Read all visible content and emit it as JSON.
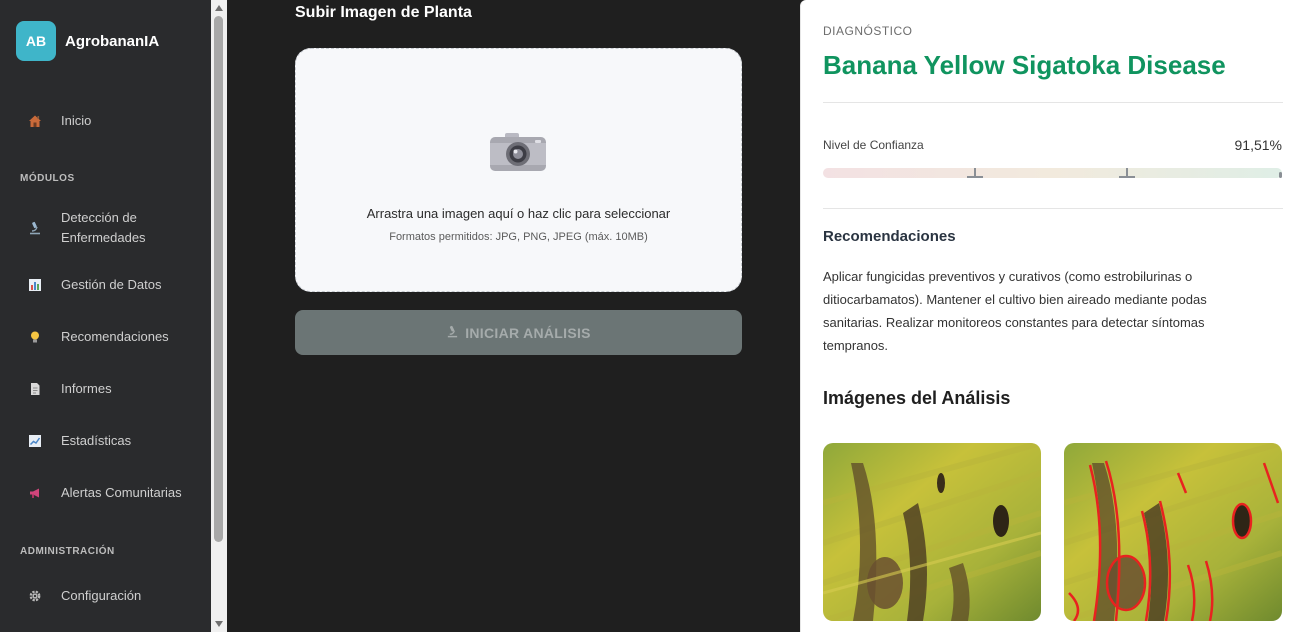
{
  "brand": {
    "logo_text": "AB",
    "name": "AgrobananIA"
  },
  "sidebar": {
    "home": {
      "label": "Inicio",
      "icon": "house-icon"
    },
    "modules_title": "MÓDULOS",
    "modules": [
      {
        "label": "Detección de Enfermedades",
        "icon": "microscope-icon"
      },
      {
        "label": "Gestión de Datos",
        "icon": "bar-chart-icon"
      },
      {
        "label": "Recomendaciones",
        "icon": "lightbulb-icon"
      },
      {
        "label": "Informes",
        "icon": "document-icon"
      },
      {
        "label": "Estadísticas",
        "icon": "line-chart-icon"
      },
      {
        "label": "Alertas Comunitarias",
        "icon": "megaphone-icon"
      }
    ],
    "admin_title": "ADMINISTRACIÓN",
    "admin": [
      {
        "label": "Configuración",
        "icon": "gear-icon"
      }
    ]
  },
  "upload": {
    "title": "Subir Imagen de Planta",
    "drop_text": "Arrastra una imagen aquí o haz clic para seleccionar",
    "formats_text": "Formatos permitidos: JPG, PNG, JPEG (máx. 10MB)",
    "start_button": "INICIAR ANÁLISIS"
  },
  "result": {
    "diagnosis_label": "DIAGNÓSTICO",
    "diagnosis": "Banana Yellow Sigatoka Disease",
    "confidence_label": "Nivel de Confianza",
    "confidence_value": "91,51%",
    "confidence_fraction": 0.9151,
    "recommendations_title": "Recomendaciones",
    "recommendations_text": "Aplicar fungicidas preventivos y curativos (como estrobilurinas o ditiocarbamatos). Mantener el cultivo bien aireado mediante podas sanitarias. Realizar monitoreos constantes para detectar síntomas tempranos.",
    "images_title": "Imágenes del Análisis"
  },
  "colors": {
    "accent": "#10945f",
    "logo": "#3fb5c9",
    "sidebar_bg": "#2a2b2d"
  }
}
